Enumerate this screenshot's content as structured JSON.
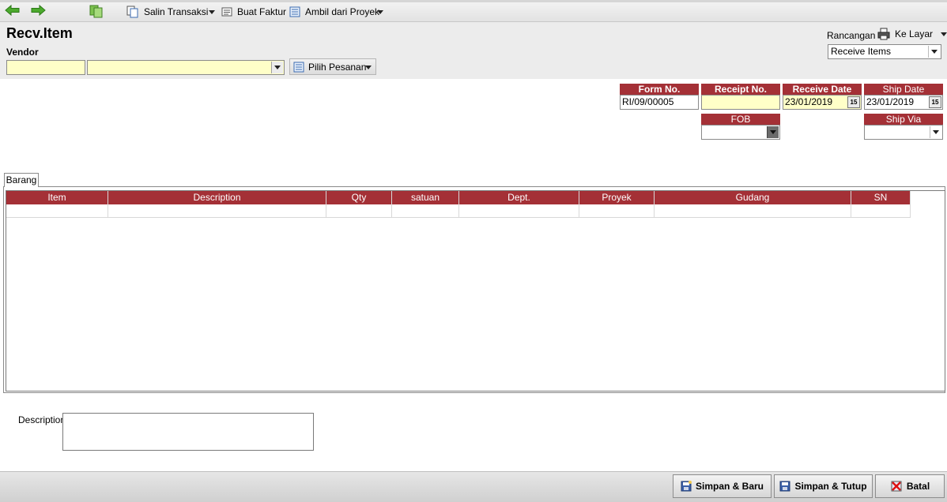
{
  "toolbar": {
    "salin_transaksi": "Salin Transaksi",
    "buat_faktur": "Buat Faktur",
    "ambil_dari_proyek": "Ambil dari Proyek"
  },
  "header": {
    "title": "Recv.Item",
    "vendor_label": "Vendor",
    "pilih_pesanan": "Pilih Pesanan",
    "rancangan_label": "Rancangan",
    "ke_layar": "Ke Layar",
    "template_value": "Receive Items"
  },
  "fields": {
    "form_no": {
      "label": "Form No.",
      "value": "RI/09/00005"
    },
    "receipt_no": {
      "label": "Receipt No.",
      "value": ""
    },
    "receive_date": {
      "label": "Receive Date",
      "value": "23/01/2019"
    },
    "ship_date": {
      "label": "Ship Date",
      "value": "23/01/2019"
    },
    "fob": {
      "label": "FOB",
      "value": ""
    },
    "ship_via": {
      "label": "Ship Via",
      "value": ""
    },
    "calendar_glyph": "15"
  },
  "tabs": [
    {
      "label": "Barang"
    }
  ],
  "grid": {
    "columns": [
      "Item",
      "Description",
      "Qty",
      "satuan",
      "Dept.",
      "Proyek",
      "Gudang",
      "SN"
    ]
  },
  "description_label": "Description",
  "footer": {
    "simpan_baru": "Simpan & Baru",
    "simpan_tutup": "Simpan & Tutup",
    "batal": "Batal"
  },
  "colors": {
    "header_red": "#a43036",
    "required_yellow": "#ffffc8"
  }
}
